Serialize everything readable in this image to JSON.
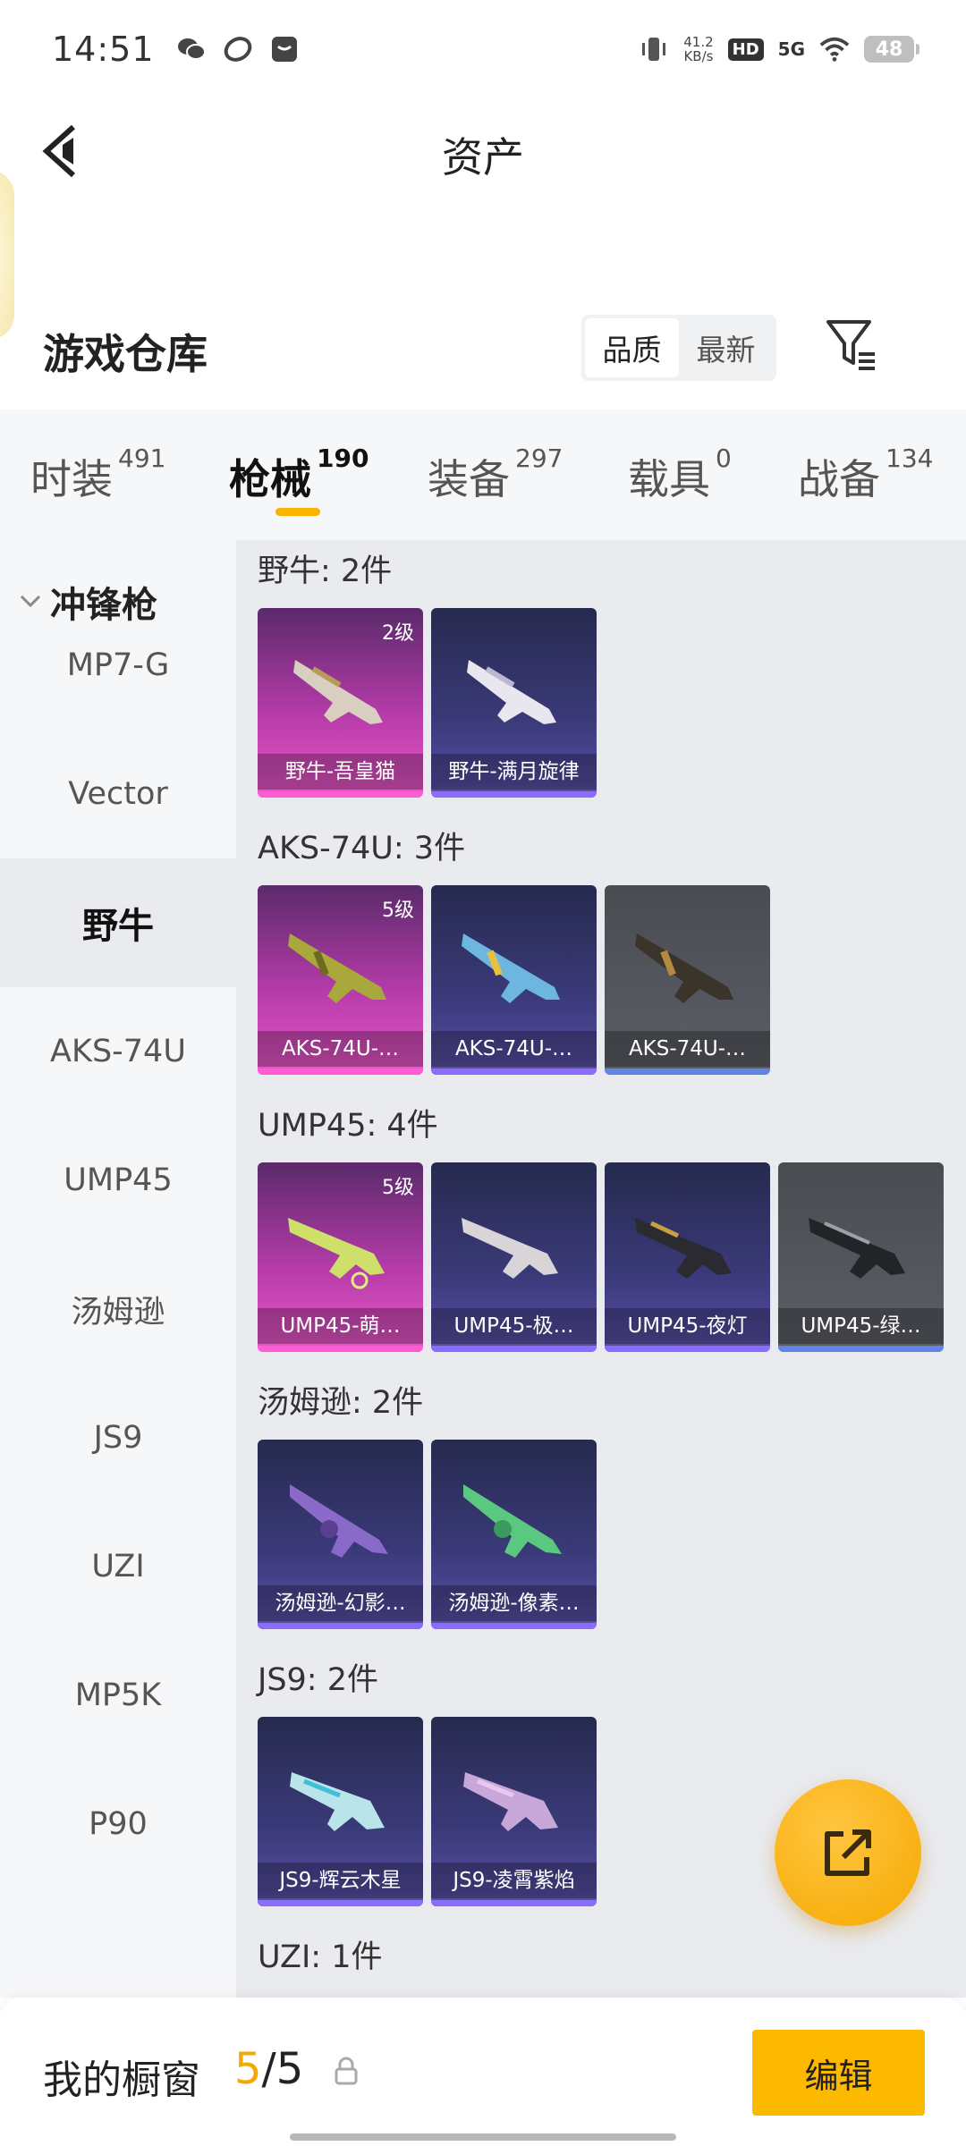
{
  "status_bar": {
    "time": "14:51",
    "net_speed_value": "41.2",
    "net_speed_unit": "KB/s",
    "hd": "HD",
    "network": "5G",
    "battery": "48",
    "icons": [
      "wechat-icon",
      "app-icon",
      "message-icon",
      "vibrate-icon",
      "wifi-icon"
    ]
  },
  "header": {
    "title": "资产"
  },
  "warehouse": {
    "title": "游戏仓库",
    "sort_options": [
      "品质",
      "最新"
    ],
    "active_sort": "品质"
  },
  "tabs": [
    {
      "label": "时装",
      "count": "491"
    },
    {
      "label": "枪械",
      "count": "190",
      "active": true
    },
    {
      "label": "装备",
      "count": "297"
    },
    {
      "label": "载具",
      "count": "0"
    },
    {
      "label": "战备",
      "count": "134"
    }
  ],
  "sidebar": {
    "header": "冲锋枪",
    "items": [
      "MP7-G",
      "Vector",
      "野牛",
      "AKS-74U",
      "UMP45",
      "汤姆逊",
      "JS9",
      "UZI",
      "MP5K",
      "P90"
    ],
    "active": "野牛"
  },
  "groups": [
    {
      "title": "野牛: 2件",
      "items": [
        {
          "label": "野牛-吾皇猫",
          "level": "2级",
          "rarity": "pink"
        },
        {
          "label": "野牛-满月旋律",
          "level": "",
          "rarity": "purple"
        }
      ]
    },
    {
      "title": "AKS-74U: 3件",
      "items": [
        {
          "label": "AKS-74U-…",
          "level": "5级",
          "rarity": "pink"
        },
        {
          "label": "AKS-74U-…",
          "level": "",
          "rarity": "purple"
        },
        {
          "label": "AKS-74U-…",
          "level": "",
          "rarity": "gray"
        }
      ]
    },
    {
      "title": "UMP45: 4件",
      "items": [
        {
          "label": "UMP45-萌…",
          "level": "5级",
          "rarity": "pink"
        },
        {
          "label": "UMP45-极…",
          "level": "",
          "rarity": "purple"
        },
        {
          "label": "UMP45-夜灯",
          "level": "",
          "rarity": "purple"
        },
        {
          "label": "UMP45-绿…",
          "level": "",
          "rarity": "gray"
        }
      ]
    },
    {
      "title": "汤姆逊: 2件",
      "items": [
        {
          "label": "汤姆逊-幻影…",
          "level": "",
          "rarity": "purple"
        },
        {
          "label": "汤姆逊-像素…",
          "level": "",
          "rarity": "purple"
        }
      ]
    },
    {
      "title": "JS9: 2件",
      "items": [
        {
          "label": "JS9-辉云木星",
          "level": "",
          "rarity": "purple"
        },
        {
          "label": "JS9-凌霄紫焰",
          "level": "",
          "rarity": "purple"
        }
      ]
    },
    {
      "title": "UZI: 1件",
      "items": []
    }
  ],
  "bottom_bar": {
    "showcase_label": "我的橱窗",
    "showcase_current": "5",
    "showcase_total": "/5",
    "edit_label": "编辑"
  },
  "colors": {
    "accent": "#f8b400",
    "pink_rarity": "#ea57c8",
    "purple_rarity": "#5a51a8",
    "gray_rarity": "#5c5e66"
  }
}
